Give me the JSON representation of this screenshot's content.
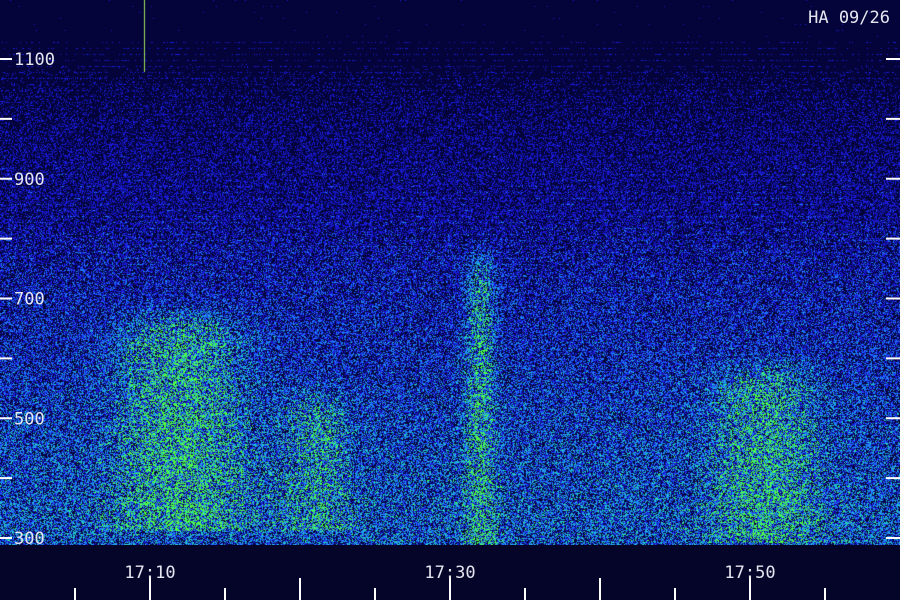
{
  "chart_data": {
    "type": "heatmap",
    "title": "",
    "station_label": "HA 09/26",
    "xlabel": "",
    "ylabel": "",
    "x_ticks": [
      "17:10",
      "17:30",
      "17:50"
    ],
    "y_ticks": [
      300,
      500,
      700,
      900,
      1100
    ],
    "ylim": [
      300,
      1150
    ],
    "xlim_minutes_labels": [
      "17:05",
      "17:56"
    ],
    "colormap": [
      "#04043a",
      "#1a1ad8",
      "#1e7bff",
      "#22c9c9",
      "#4fff40"
    ],
    "bright_regions": [
      {
        "time": "17:12",
        "freq_min": 330,
        "freq_max": 650,
        "intensity": 0.95
      },
      {
        "time": "17:21",
        "freq_min": 330,
        "freq_max": 520,
        "intensity": 0.55
      },
      {
        "time": "17:32",
        "freq_min": 300,
        "freq_max": 750,
        "intensity": 0.75
      },
      {
        "time": "17:51",
        "freq_min": 310,
        "freq_max": 560,
        "intensity": 0.8
      }
    ]
  }
}
